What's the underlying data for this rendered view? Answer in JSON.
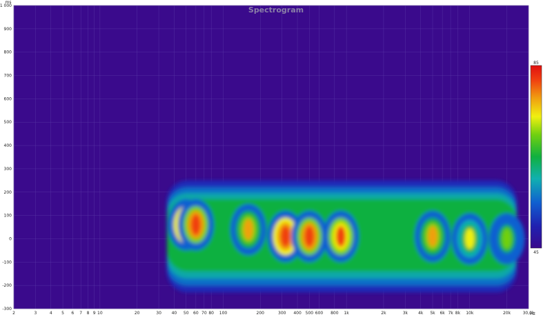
{
  "chart_data": {
    "type": "heatmap",
    "title": "Spectrogram",
    "x_unit": "Hz",
    "y_unit": "ms",
    "x_scale": "log",
    "xlim": [
      2,
      30000
    ],
    "ylim": [
      -300,
      1000
    ],
    "x_ticks": [
      "2",
      "3",
      "4",
      "5",
      "6",
      "7",
      "8",
      "9",
      "10",
      "20",
      "30",
      "40",
      "50",
      "60",
      "70",
      "80",
      "100",
      "200",
      "300",
      "400",
      "500",
      "600",
      "800",
      "1k",
      "2k",
      "3k",
      "4k",
      "5k",
      "6k",
      "7k",
      "8k",
      "10k",
      "20k",
      "30,0k"
    ],
    "y_ticks": [
      "1 000",
      "900",
      "800",
      "700",
      "600",
      "500",
      "400",
      "300",
      "200",
      "100",
      "0",
      "-100",
      "-200",
      "-300"
    ],
    "colorbar": {
      "max_label": "85",
      "min_label": "45",
      "min": 45,
      "max": 85
    },
    "grid": true,
    "background": "#3a0a8c",
    "hot_spots": [
      {
        "freq_hz": 50,
        "time_ms": 60,
        "level_db": 85
      },
      {
        "freq_hz": 60,
        "time_ms": 60,
        "level_db": 83
      },
      {
        "freq_hz": 160,
        "time_ms": 40,
        "level_db": 78
      },
      {
        "freq_hz": 320,
        "time_ms": 10,
        "level_db": 84
      },
      {
        "freq_hz": 500,
        "time_ms": 10,
        "level_db": 83
      },
      {
        "freq_hz": 900,
        "time_ms": 10,
        "level_db": 82
      },
      {
        "freq_hz": 5000,
        "time_ms": 10,
        "level_db": 78
      },
      {
        "freq_hz": 10000,
        "time_ms": 0,
        "level_db": 74
      },
      {
        "freq_hz": 20000,
        "time_ms": 0,
        "level_db": 70
      }
    ]
  }
}
